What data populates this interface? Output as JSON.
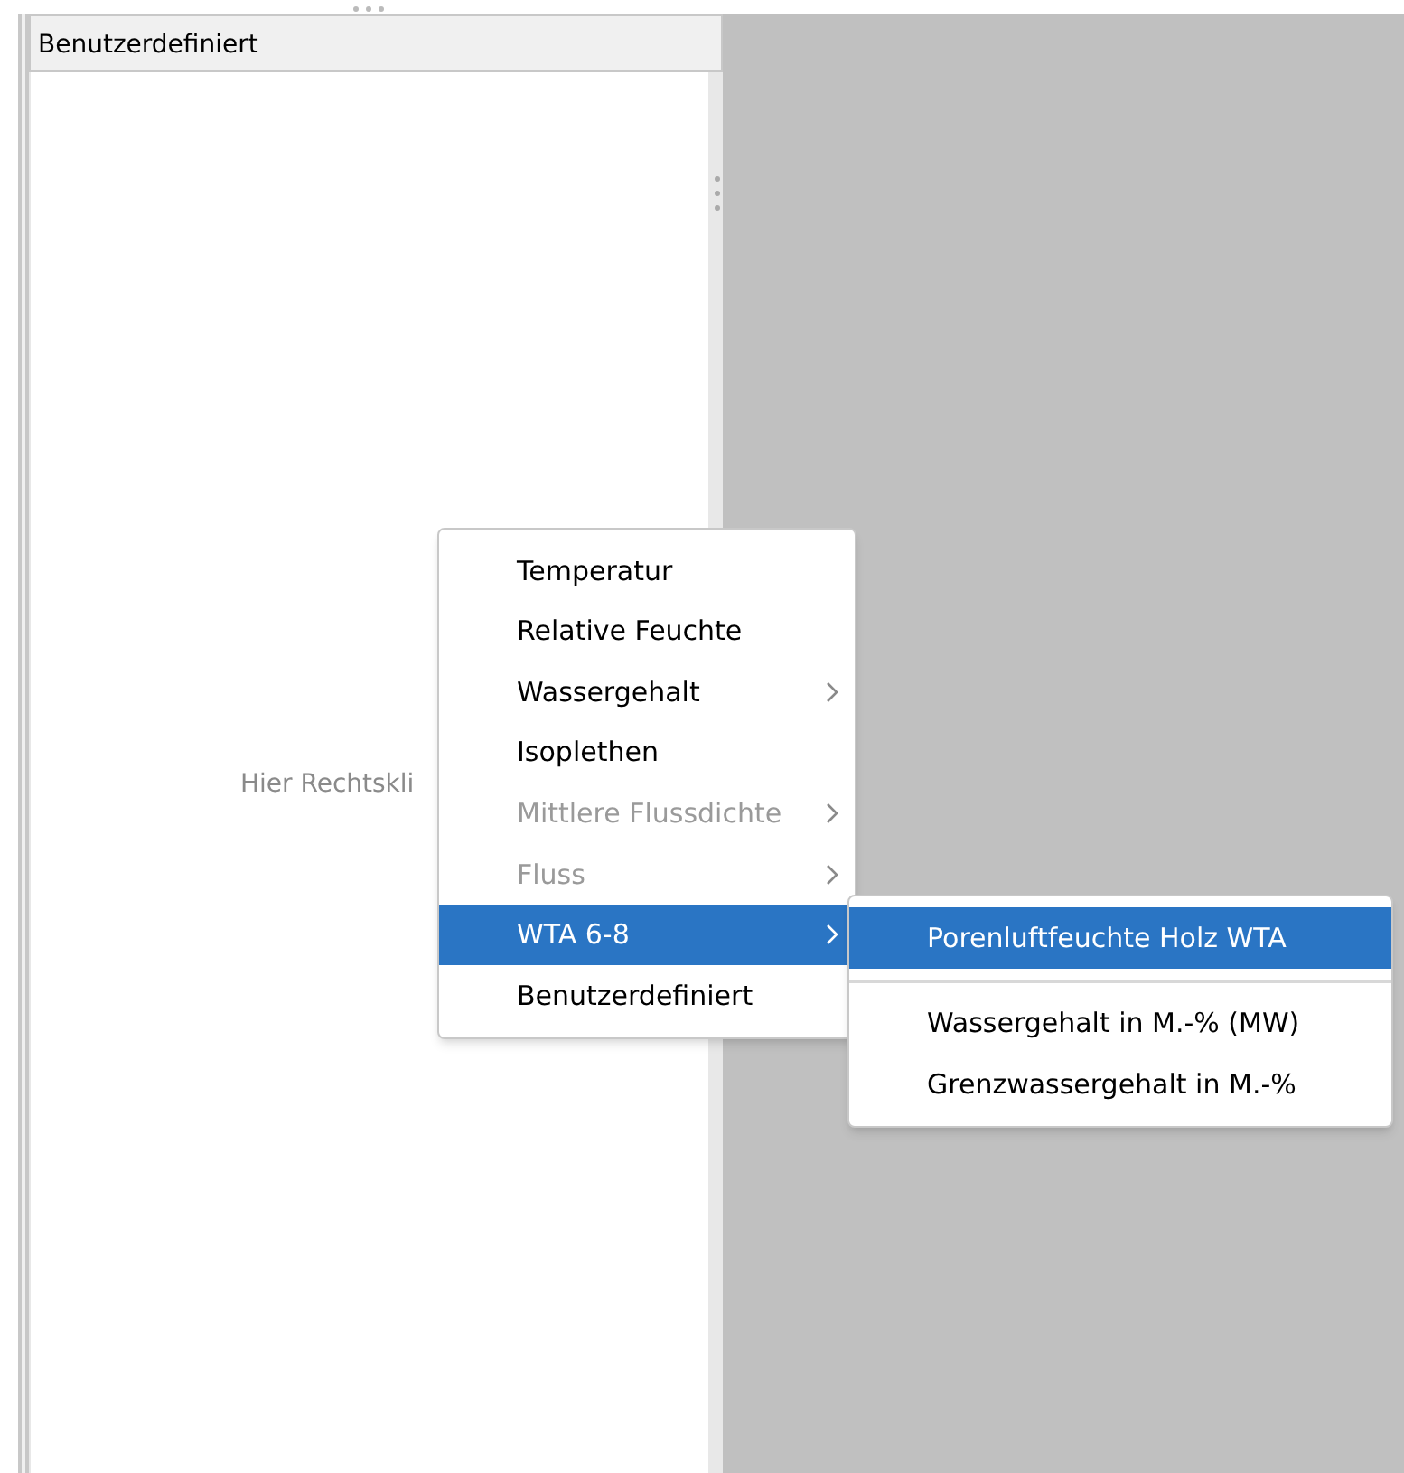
{
  "panel": {
    "title": "Benutzerdefiniert",
    "hint": "Hier Rechtskli"
  },
  "context_menu": {
    "items": [
      {
        "label": "Temperatur",
        "submenu": false,
        "disabled": false,
        "selected": false
      },
      {
        "label": "Relative Feuchte",
        "submenu": false,
        "disabled": false,
        "selected": false
      },
      {
        "label": "Wassergehalt",
        "submenu": true,
        "disabled": false,
        "selected": false
      },
      {
        "label": "Isoplethen",
        "submenu": false,
        "disabled": false,
        "selected": false
      },
      {
        "label": "Mittlere Flussdichte",
        "submenu": true,
        "disabled": true,
        "selected": false
      },
      {
        "label": "Fluss",
        "submenu": true,
        "disabled": true,
        "selected": false
      },
      {
        "label": "WTA 6-8",
        "submenu": true,
        "disabled": false,
        "selected": true
      },
      {
        "label": "Benutzerdefiniert",
        "submenu": false,
        "disabled": false,
        "selected": false
      }
    ]
  },
  "submenu": {
    "items": [
      {
        "kind": "item",
        "label": "Porenluftfeuchte Holz WTA",
        "selected": true
      },
      {
        "kind": "separator"
      },
      {
        "kind": "item",
        "label": "Wassergehalt in M.-% (MW)",
        "selected": false
      },
      {
        "kind": "item",
        "label": "Grenzwassergehalt in M.-%",
        "selected": false
      }
    ]
  }
}
